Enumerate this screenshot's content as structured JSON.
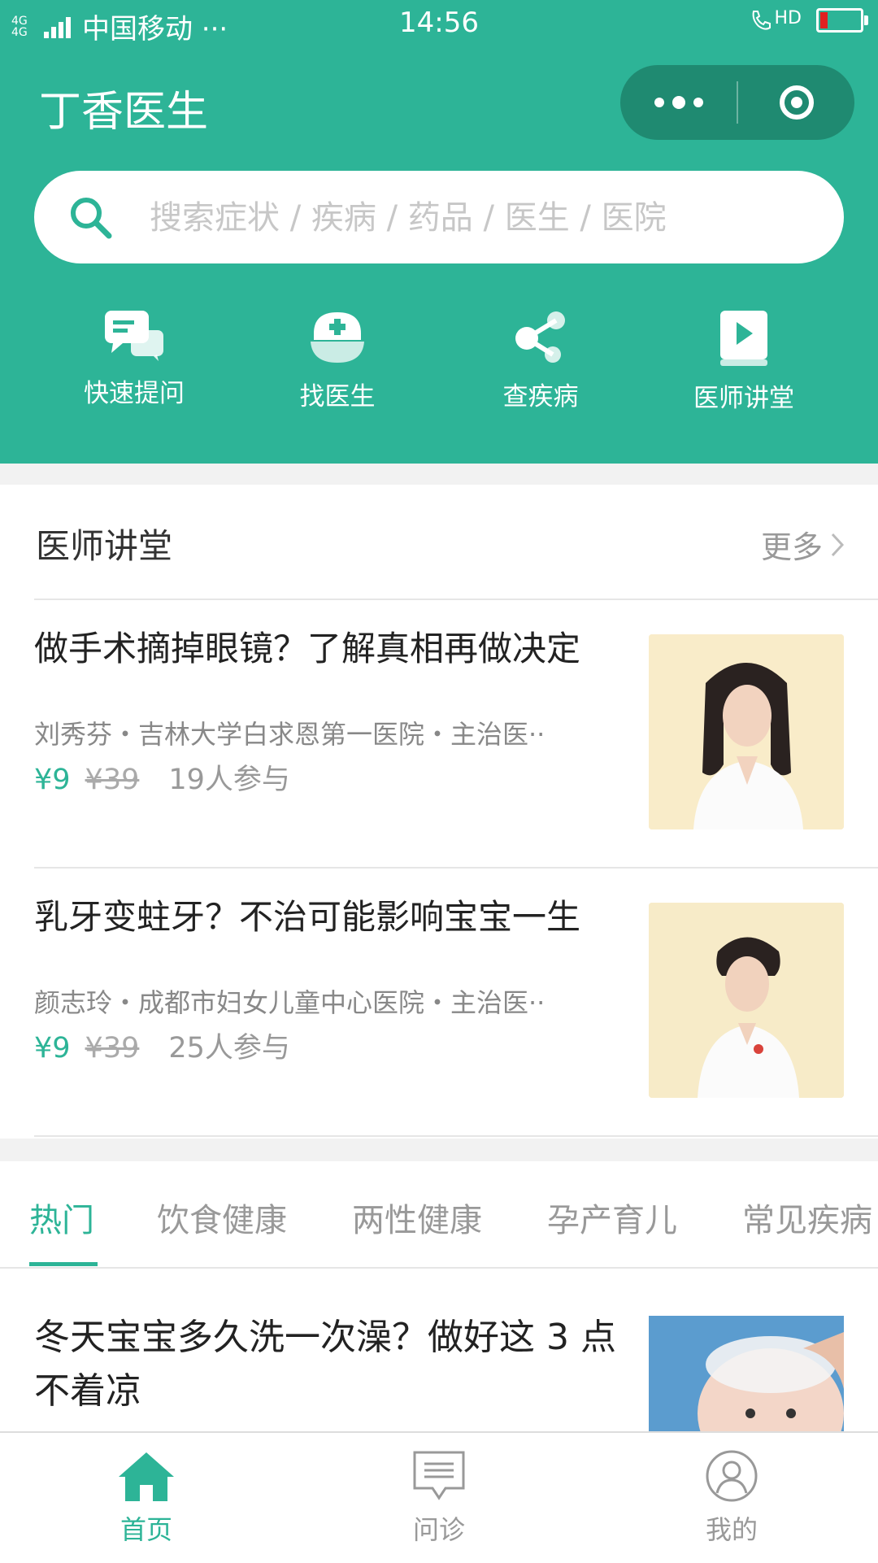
{
  "status_bar": {
    "network": "4G 4G",
    "carrier": "中国移动 ···",
    "time": "14:56",
    "hd_label": "HD",
    "battery_color": "#e02020"
  },
  "nav": {
    "title": "丁香医生",
    "more_icon": "more-dots-icon",
    "close_icon": "target-close-icon"
  },
  "search": {
    "placeholder": "搜索症状 / 疾病 / 药品 / 医生 / 医院",
    "icon": "search-icon"
  },
  "quick_actions": [
    {
      "label": "快速提问",
      "icon": "chat-bubbles-icon"
    },
    {
      "label": "找医生",
      "icon": "nurse-cap-icon"
    },
    {
      "label": "查疾病",
      "icon": "share-nodes-icon"
    },
    {
      "label": "医师讲堂",
      "icon": "video-book-icon"
    }
  ],
  "lecture_section": {
    "title": "医师讲堂",
    "more_label": "更多"
  },
  "courses": [
    {
      "title": "做手术摘掉眼镜？了解真相再做决定",
      "meta": "刘秀芬・吉林大学白求恩第一医院・主治医··",
      "price": "¥9",
      "original_price": "¥39",
      "participants": "19人参与"
    },
    {
      "title": "乳牙变蛀牙？不治可能影响宝宝一生",
      "meta": "颜志玲・成都市妇女儿童中心医院・主治医··",
      "price": "¥9",
      "original_price": "¥39",
      "participants": "25人参与"
    }
  ],
  "category_tabs": [
    "热门",
    "饮食健康",
    "两性健康",
    "孕产育儿",
    "常见疾病"
  ],
  "active_tab": "热门",
  "articles": [
    {
      "title": "冬天宝宝多久洗一次澡？做好这 3 点不着凉"
    }
  ],
  "tab_bar": [
    {
      "label": "首页",
      "icon": "home-icon",
      "active": true
    },
    {
      "label": "问诊",
      "icon": "consult-message-icon",
      "active": false
    },
    {
      "label": "我的",
      "icon": "profile-icon",
      "active": false
    }
  ],
  "colors": {
    "brand": "#2db497",
    "brand_dark": "#1f8a71",
    "muted": "#999999"
  }
}
